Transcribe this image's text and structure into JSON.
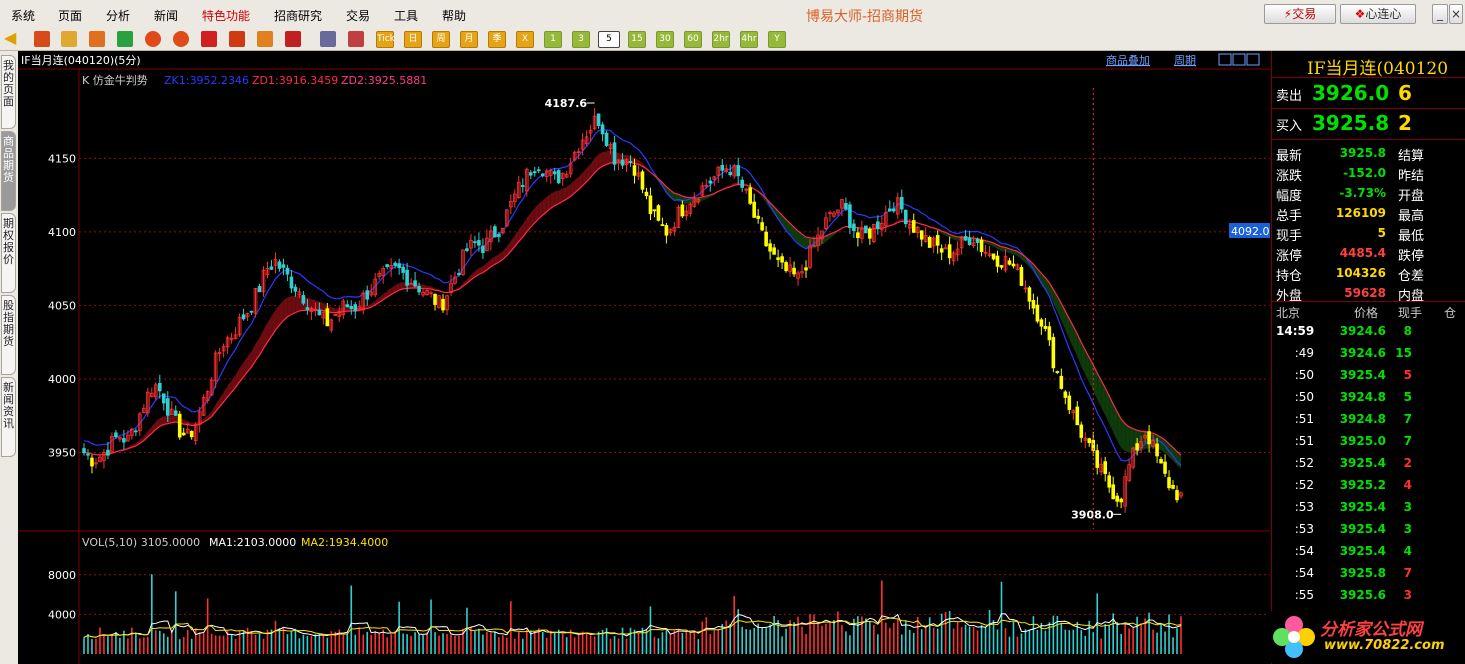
{
  "menu": [
    "系统",
    "页面",
    "分析",
    "新闻",
    "特色功能",
    "招商研究",
    "交易",
    "工具",
    "帮助"
  ],
  "menu_highlight": "特色功能",
  "app_title": "博易大师-招商期货",
  "trade_button": "交易",
  "heart_button": "心连心",
  "toolbar_periods": [
    "Tick",
    "日",
    "周",
    "月",
    "季",
    "X",
    "1",
    "3",
    "5",
    "15",
    "30",
    "60",
    "2hr",
    "4hr",
    "Y"
  ],
  "selected_period": "5",
  "left_tabs": [
    "我的页面",
    "商品期货",
    "期权报价",
    "股指期货",
    "新闻资讯"
  ],
  "chart_header": {
    "title": "IF当月连(040120)(5分)",
    "links": [
      "商品叠加",
      "周期"
    ],
    "indicator_prefix": "K 仿金牛判势",
    "zk1": "ZK1:3952.2346",
    "zd1": "ZD1:3916.3459",
    "zd2": "ZD2:3925.5881",
    "vol_label": "VOL(5,10) 3105.0000",
    "ma1_label": "MA1:2103.0000",
    "ma2_label": "MA2:1934.4000",
    "high_marker": "4187.6",
    "low_marker": "3908.0",
    "cursor_price": "4092.0"
  },
  "chart_data": {
    "type": "candlestick",
    "title": "IF当月连(040120)(5分)",
    "y_ticks": [
      4150,
      4100,
      4050,
      4000,
      3950
    ],
    "y_range": [
      3898,
      4208
    ],
    "vol_ticks": [
      8000,
      4000
    ],
    "vol_range": [
      0,
      10400
    ],
    "high": 4187.6,
    "low": 3908.0,
    "close_path": [
      3950,
      3945,
      3948,
      3955,
      3962,
      3958,
      3970,
      3985,
      3997,
      3990,
      3975,
      3965,
      3960,
      3972,
      3990,
      4010,
      4025,
      4030,
      4040,
      4048,
      4060,
      4075,
      4080,
      4072,
      4065,
      4058,
      4050,
      4042,
      4038,
      4045,
      4050,
      4048,
      4055,
      4062,
      4068,
      4072,
      4075,
      4070,
      4065,
      4060,
      4055,
      4050,
      4062,
      4075,
      4088,
      4092,
      4090,
      4098,
      4105,
      4118,
      4130,
      4140,
      4148,
      4142,
      4135,
      4140,
      4150,
      4162,
      4170,
      4178,
      4165,
      4150,
      4150,
      4148,
      4132,
      4115,
      4105,
      4100,
      4110,
      4118,
      4125,
      4130,
      4135,
      4140,
      4145,
      4138,
      4125,
      4110,
      4095,
      4085,
      4075,
      4072,
      4068,
      4080,
      4092,
      4105,
      4112,
      4118,
      4108,
      4095,
      4098,
      4105,
      4112,
      4120,
      4115,
      4105,
      4100,
      4092,
      4090,
      4085,
      4088,
      4092,
      4098,
      4090,
      4085,
      4082,
      4080,
      4075,
      4065,
      4050,
      4040,
      4020,
      4000,
      3985,
      3970,
      3958,
      3945,
      3935,
      3925,
      3918,
      3940,
      3955,
      3965,
      3950,
      3935,
      3925,
      3920
    ]
  },
  "right_panel": {
    "title": "IF当月连(040120",
    "sell": {
      "label": "卖出",
      "price": "3926.0",
      "vol": "6"
    },
    "buy": {
      "label": "买入",
      "price": "3925.8",
      "vol": "2"
    },
    "stats": [
      {
        "label": "最新",
        "value": "3925.8",
        "color": "#00e000",
        "right": "结算"
      },
      {
        "label": "涨跌",
        "value": "-152.0",
        "color": "#00e000",
        "right": "昨结"
      },
      {
        "label": "幅度",
        "value": "-3.73%",
        "color": "#00e000",
        "right": "开盘"
      },
      {
        "label": "总手",
        "value": "126109",
        "color": "#ffd800",
        "right": "最高"
      },
      {
        "label": "现手",
        "value": "5",
        "color": "#ffd800",
        "right": "最低"
      },
      {
        "label": "涨停",
        "value": "4485.4",
        "color": "#ff4040",
        "right": "跌停"
      },
      {
        "label": "持仓",
        "value": "104326",
        "color": "#ffd800",
        "right": "仓差"
      },
      {
        "label": "外盘",
        "value": "59628",
        "color": "#ff4040",
        "right": "内盘"
      }
    ],
    "ticks_header": [
      "北京",
      "价格",
      "现手",
      "仓"
    ],
    "ticks": [
      {
        "time": "14:59",
        "price": "3924.6",
        "vol": "8",
        "color": "#00e000"
      },
      {
        "time": ":49",
        "price": "3924.6",
        "vol": "15",
        "color": "#00e000"
      },
      {
        "time": ":50",
        "price": "3925.4",
        "vol": "5",
        "color": "#ff3030"
      },
      {
        "time": ":50",
        "price": "3924.8",
        "vol": "5",
        "color": "#00e000"
      },
      {
        "time": ":51",
        "price": "3924.8",
        "vol": "7",
        "color": "#00e000"
      },
      {
        "time": ":51",
        "price": "3925.0",
        "vol": "7",
        "color": "#00e000"
      },
      {
        "time": ":52",
        "price": "3925.4",
        "vol": "2",
        "color": "#ff3030"
      },
      {
        "time": ":52",
        "price": "3925.2",
        "vol": "4",
        "color": "#ff3030"
      },
      {
        "time": ":53",
        "price": "3925.4",
        "vol": "3",
        "color": "#00e000"
      },
      {
        "time": ":53",
        "price": "3925.4",
        "vol": "3",
        "color": "#00e000"
      },
      {
        "time": ":54",
        "price": "3925.4",
        "vol": "4",
        "color": "#00e000"
      },
      {
        "time": ":54",
        "price": "3925.8",
        "vol": "7",
        "color": "#ff3030"
      },
      {
        "time": ":55",
        "price": "3925.6",
        "vol": "3",
        "color": "#ff3030"
      }
    ]
  },
  "watermark": {
    "line1": "分析家公式网",
    "line2": "www.70822.com"
  }
}
